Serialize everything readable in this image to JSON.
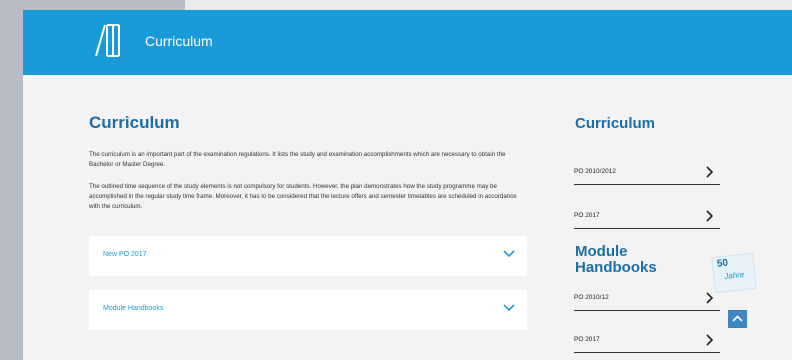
{
  "header": {
    "title": "Curriculum"
  },
  "main": {
    "title": "Curriculum",
    "paragraphs": [
      "The curriculum is an important part of the examination regulations. It lists the study and examination accomplishments which are necessary to obtain the Bachelor or Master Degree.",
      "The outlined time sequence of the study elements is not compulsory for students. However, the plan demonstrates how the study programme may be accomplished in the regular study time frame. Moreover, it has to be considered that the lecture offers and semester timetables are scheduled in accordance with the curriculum."
    ],
    "accordions": [
      {
        "label": "New PO 2017"
      },
      {
        "label": "Module Handbooks"
      }
    ]
  },
  "sidebar": {
    "title": "Curriculum",
    "curriculum_items": [
      {
        "label": "PO 2010/2012"
      },
      {
        "label": "PO 2017"
      }
    ],
    "handbooks_title": "Module Handbooks",
    "handbook_items": [
      {
        "label": "PO 2010/12"
      },
      {
        "label": "PO 2017"
      }
    ]
  },
  "badge": {
    "number": "50",
    "text": "Jahre"
  },
  "colors": {
    "primary": "#1b9ad8",
    "heading": "#1b6fa6",
    "background": "#f3f3f3"
  }
}
